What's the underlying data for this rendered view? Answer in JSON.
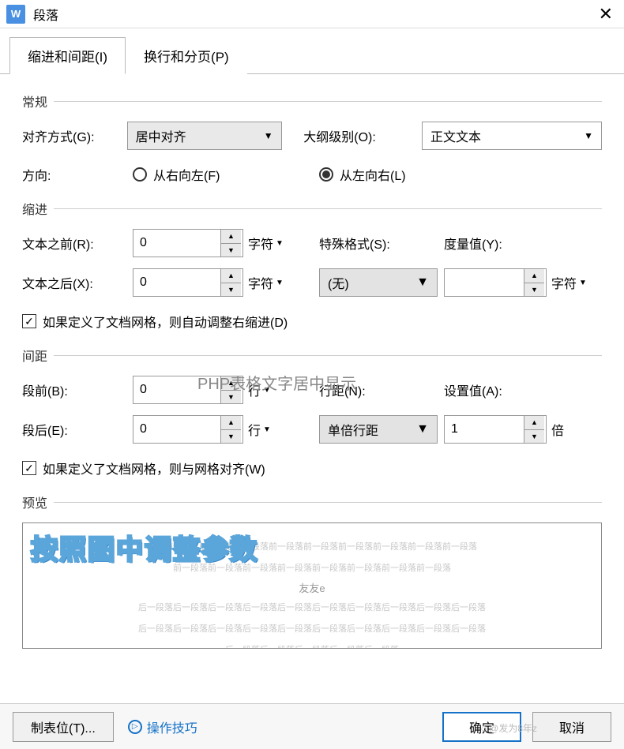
{
  "titlebar": {
    "icon": "W",
    "title": "段落"
  },
  "tabs": {
    "indent_spacing": "缩进和间距(I)",
    "line_page": "换行和分页(P)"
  },
  "general": {
    "header": "常规",
    "alignment_label": "对齐方式(G):",
    "alignment_value": "居中对齐",
    "outline_label": "大纲级别(O):",
    "outline_value": "正文文本",
    "direction_label": "方向:",
    "direction_rtl": "从右向左(F)",
    "direction_ltr": "从左向右(L)"
  },
  "indent": {
    "header": "缩进",
    "before_label": "文本之前(R):",
    "before_value": "0",
    "after_label": "文本之后(X):",
    "after_value": "0",
    "unit_char": "字符",
    "special_label": "特殊格式(S):",
    "special_value": "(无)",
    "measure_label": "度量值(Y):",
    "measure_value": "",
    "measure_unit": "字符",
    "auto_adjust": "如果定义了文档网格，则自动调整右缩进(D)"
  },
  "spacing": {
    "header": "间距",
    "before_label": "段前(B):",
    "before_value": "0",
    "after_label": "段后(E):",
    "after_value": "0",
    "unit_line": "行",
    "linespacing_label": "行距(N):",
    "linespacing_value": "单倍行距",
    "setvalue_label": "设置值(A):",
    "setvalue_value": "1",
    "setvalue_unit": "倍",
    "snap_to_grid": "如果定义了文档网格，则与网格对齐(W)"
  },
  "watermark": "PHP表格文字居中显示",
  "preview": {
    "header": "预览",
    "overlay": "按照图中调整参数",
    "grey1": "段落前一段落前一段落前一段落前一段落前一段落前一段落前一段落前一段落前一段落",
    "grey2": "前一段落前一段落前一段落前一段落前一段落前一段落前一段落前一段落",
    "sample": "友友e",
    "grey3": "后一段落后一段落后一段落后一段落后一段落后一段落后一段落后一段落后一段落后一段落",
    "grey4": "后一段落后一段落后一段落后一段落后一段落后一段落后一段落后一段落后一段落后一段落",
    "grey5": "后一段落后一段落后一段落后一段落后一段落"
  },
  "footer": {
    "tabs_btn": "制表位(T)...",
    "tips": "操作技巧",
    "ok": "确定",
    "cancel": "取消",
    "credit": "☺@发为8年z"
  }
}
